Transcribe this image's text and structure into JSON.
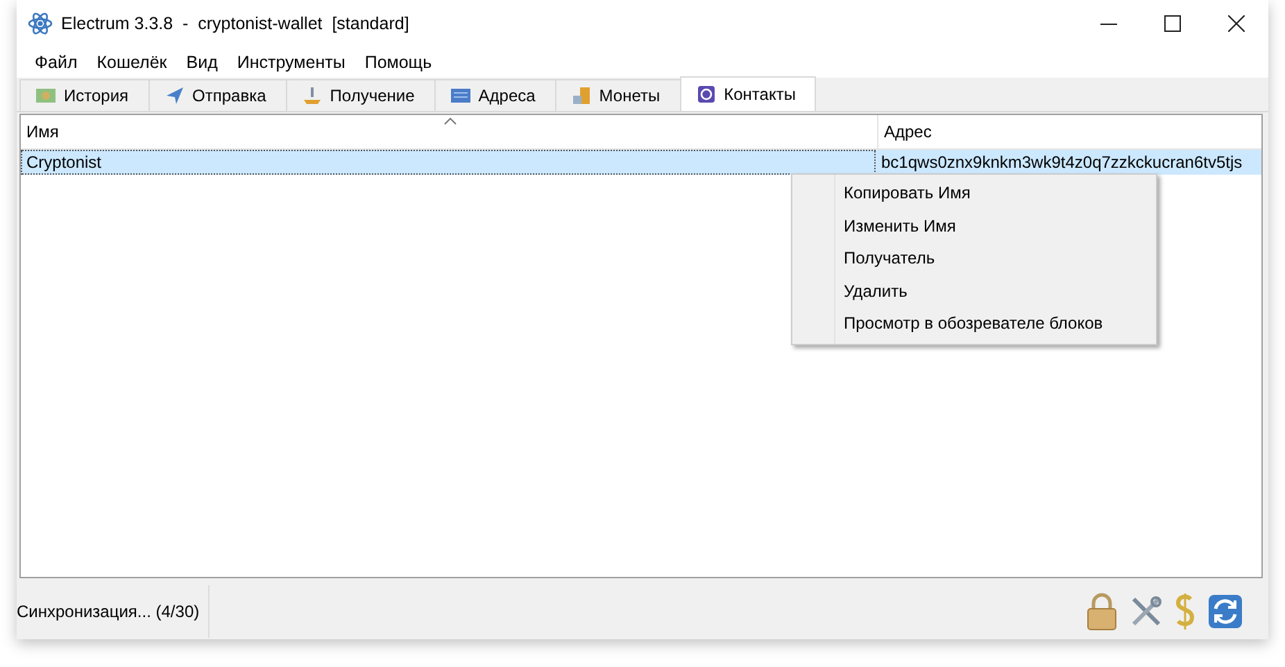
{
  "window": {
    "title": "Electrum 3.3.8  -  cryptonist-wallet  [standard]"
  },
  "menu": [
    "Файл",
    "Кошелёк",
    "Вид",
    "Инструменты",
    "Помощь"
  ],
  "tabs": [
    {
      "label": "История",
      "selected": false
    },
    {
      "label": "Отправка",
      "selected": false
    },
    {
      "label": "Получение",
      "selected": false
    },
    {
      "label": "Адреса",
      "selected": false
    },
    {
      "label": "Монеты",
      "selected": false
    },
    {
      "label": "Контакты",
      "selected": true
    }
  ],
  "table": {
    "columns": [
      "Имя",
      "Адрес"
    ],
    "rows": [
      {
        "cells": [
          "Cryptonist",
          "bc1qws0znx9knkm3wk9t4z0q7zzkckucran6tv5tjs"
        ],
        "selected": true
      }
    ]
  },
  "context_menu": {
    "items": [
      "Копировать Имя",
      "Изменить Имя",
      "Получатель",
      "Удалить",
      "Просмотр в обозревателе блоков"
    ]
  },
  "status_bar": {
    "text": "Синхронизация... (4/30)"
  }
}
